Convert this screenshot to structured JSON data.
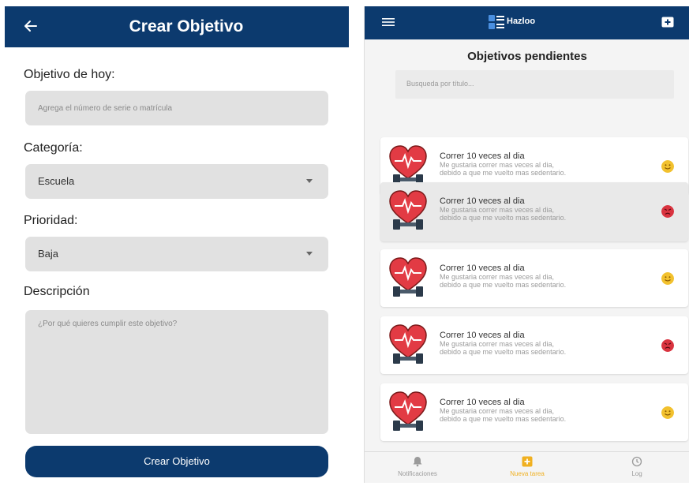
{
  "create_form": {
    "header": {
      "title": "Crear Objetivo",
      "back_icon": "back-arrow-icon"
    },
    "objective": {
      "label": "Objetivo de hoy:",
      "placeholder": "Agrega el número de serie o matrícula"
    },
    "category": {
      "label": "Categoría:",
      "value": "Escuela"
    },
    "priority": {
      "label": "Prioridad:",
      "value": "Baja"
    },
    "description": {
      "label": "Descripción",
      "placeholder": "¿Por qué quieres cumplir este objetivo?"
    },
    "submit_label": "Crear Objetivo"
  },
  "pending_list": {
    "header": {
      "brand": "Hazloo",
      "menu_icon": "hamburger-menu-icon",
      "add_icon": "add-task-icon"
    },
    "title": "Objetivos pendientes",
    "search_placeholder": "Busqueda por título...",
    "items": [
      {
        "title": "Correr 10 veces al dia",
        "desc_line1": "Me gustaria correr mas veces al dia,",
        "desc_line2": "debido a que me vuelto mas sedentario.",
        "status": "happy",
        "status_color": "#f2c12e"
      },
      {
        "title": "Correr 10 veces al dia",
        "desc_line1": "Me gustaria correr mas veces al dia,",
        "desc_line2": "debido a que me vuelto mas sedentario.",
        "status": "angry",
        "status_color": "#d9333f"
      },
      {
        "title": "Correr 10 veces al dia",
        "desc_line1": "Me gustaria correr mas veces al dia,",
        "desc_line2": "debido a que me vuelto mas sedentario.",
        "status": "happy",
        "status_color": "#f2c12e"
      },
      {
        "title": "Correr 10 veces al dia",
        "desc_line1": "Me gustaria correr mas veces al dia,",
        "desc_line2": "debido a que me vuelto mas sedentario.",
        "status": "angry",
        "status_color": "#d9333f"
      },
      {
        "title": "Correr 10 veces al dia",
        "desc_line1": "Me gustaria correr mas veces al dia,",
        "desc_line2": "debido a que me vuelto mas sedentario.",
        "status": "happy",
        "status_color": "#f2c12e"
      }
    ],
    "bottom_nav": [
      {
        "label": "Notificaciones",
        "icon": "bell-icon"
      },
      {
        "label": "Nueva tarea",
        "icon": "plus-square-icon",
        "active": true
      },
      {
        "label": "Log",
        "icon": "history-icon"
      }
    ]
  },
  "colors": {
    "primary": "#0c3a6e",
    "accent": "#f0b020",
    "field_bg": "#e1e1e1"
  }
}
